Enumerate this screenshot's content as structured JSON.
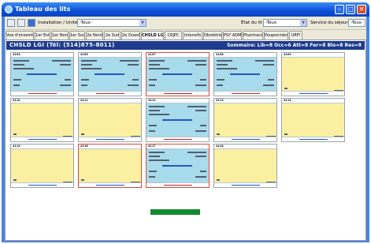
{
  "window": {
    "title": "Tableau des lits",
    "icon": "app-icon",
    "controls": [
      "minimize-icon",
      "maximize-icon",
      "close-icon"
    ]
  },
  "toolbar": {
    "installation_label": "Installation / Unité",
    "installation_value": "-Tous-",
    "etat_label": "État du lit",
    "etat_value": "-Tous-",
    "service_label": "Service du séjour",
    "service_value": "-Tous-"
  },
  "tabs": [
    "Vue d'ensemble",
    "1er Est",
    "1er Nord",
    "1er Sud",
    "2e Nord",
    "2e Sud",
    "2e Ouest",
    "CHSLD LGI",
    "CRJPC",
    "Intensifs",
    "Obstétrie",
    "PSY ADM",
    "Pharmacie",
    "Pouponnière",
    "URFI"
  ],
  "active_tab": "CHSLD LGI",
  "unit": {
    "name": "CHSLD LGI (Tél: (514)875-8011)",
    "summary": "Sommaire: Lib=8 Occ=6 Att=8 Fer=8 Blo=8 Res=8"
  },
  "beds": [
    {
      "id": "4104",
      "state": "occupied"
    },
    {
      "id": "4105",
      "state": "occupied"
    },
    {
      "id": "4107",
      "state": "occupied",
      "alert": true
    },
    {
      "id": "4108",
      "state": "occupied"
    },
    {
      "id": "4109",
      "state": "free"
    },
    {
      "id": "4110",
      "state": "free"
    },
    {
      "id": "4111",
      "state": "free"
    },
    {
      "id": "4112",
      "state": "occupied"
    },
    {
      "id": "4113",
      "state": "free"
    },
    {
      "id": "4114",
      "state": "free"
    },
    {
      "id": "4115",
      "state": "free"
    },
    {
      "id": "4116",
      "state": "free",
      "alert": true
    },
    {
      "id": "4117",
      "state": "occupied",
      "alert": true
    },
    {
      "id": "4118",
      "state": "free"
    }
  ],
  "colors": {
    "occupied": "#a8dbec",
    "free": "#fbf0a2",
    "alert_border": "#d94b3f",
    "unit_bar": "#1e3b8c",
    "status_green": "#128a2e"
  }
}
